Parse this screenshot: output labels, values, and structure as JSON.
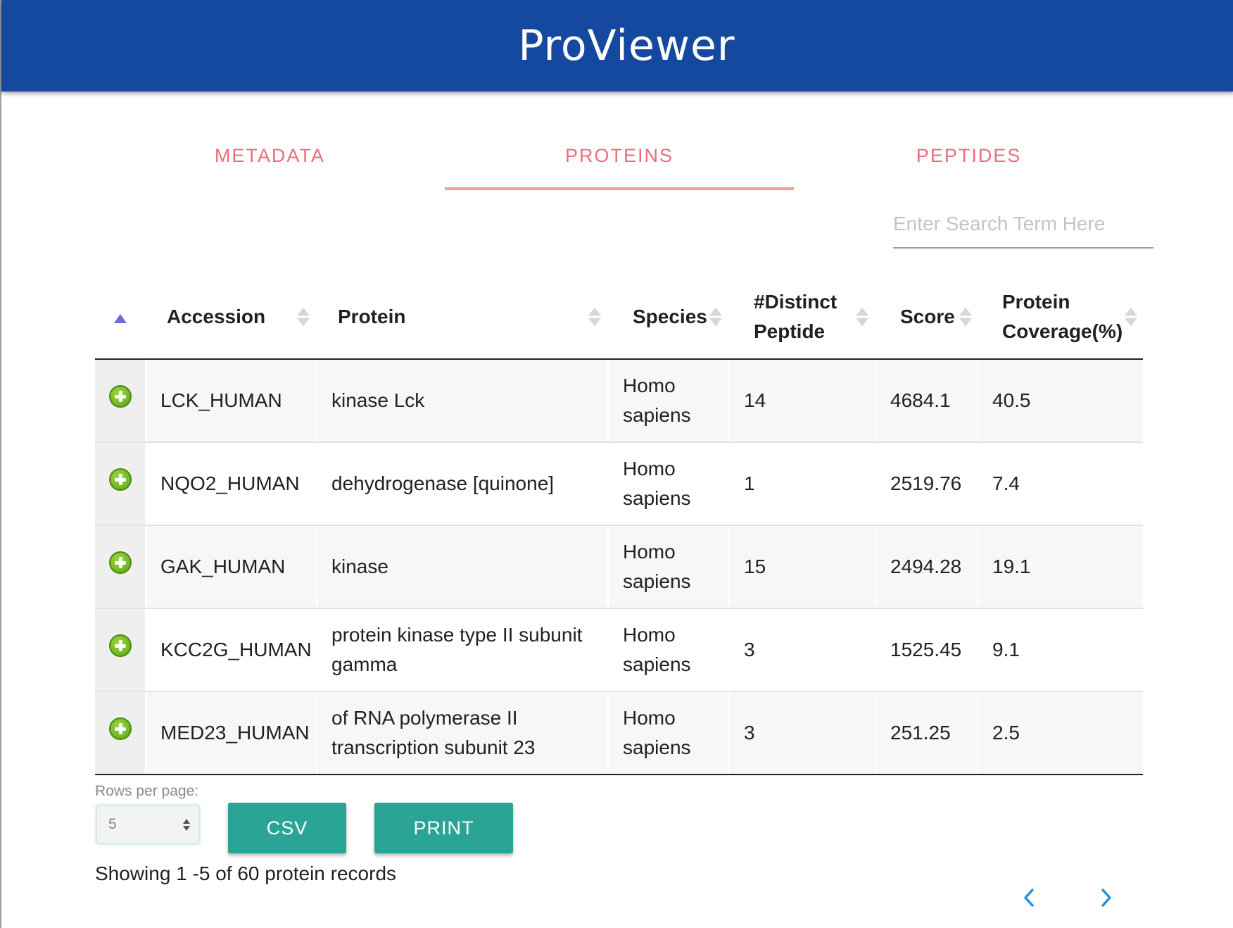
{
  "app": {
    "title": "ProViewer"
  },
  "tabs": [
    {
      "label": "METADATA",
      "active": false
    },
    {
      "label": "PROTEINS",
      "active": true
    },
    {
      "label": "PEPTIDES",
      "active": false
    }
  ],
  "search": {
    "placeholder": "Enter Search Term Here",
    "value": ""
  },
  "table": {
    "columns": [
      "Accession",
      "Protein",
      "Species",
      "#Distinct Peptide",
      "Score",
      "Protein Coverage(%)"
    ],
    "rows": [
      {
        "accession": "LCK_HUMAN",
        "protein": "kinase Lck",
        "species": "Homo sapiens",
        "distinct_peptide": "14",
        "score": "4684.1",
        "coverage": "40.5"
      },
      {
        "accession": "NQO2_HUMAN",
        "protein": "dehydrogenase [quinone]",
        "species": "Homo sapiens",
        "distinct_peptide": "1",
        "score": "2519.76",
        "coverage": "7.4"
      },
      {
        "accession": "GAK_HUMAN",
        "protein": "kinase",
        "species": "Homo sapiens",
        "distinct_peptide": "15",
        "score": "2494.28",
        "coverage": "19.1"
      },
      {
        "accession": "KCC2G_HUMAN",
        "protein": "protein kinase type II subunit gamma",
        "species": "Homo sapiens",
        "distinct_peptide": "3",
        "score": "1525.45",
        "coverage": "9.1"
      },
      {
        "accession": "MED23_HUMAN",
        "protein": "of RNA polymerase II transcription subunit 23",
        "species": "Homo sapiens",
        "distinct_peptide": "3",
        "score": "251.25",
        "coverage": "2.5"
      }
    ]
  },
  "footer": {
    "rows_per_page_label": "Rows per page:",
    "rows_per_page_value": "5",
    "csv_label": "CSV",
    "print_label": "PRINT",
    "status": "Showing 1 -5 of 60 protein records"
  },
  "colors": {
    "appbar": "#1549a0",
    "tab_text": "#ef6b78",
    "button": "#2aa595",
    "pager": "#2b8fd6"
  },
  "icons": {
    "row_expand": "plus-circle-icon",
    "sort": "sort-arrows-icon",
    "prev": "chevron-left-icon",
    "next": "chevron-right-icon"
  }
}
